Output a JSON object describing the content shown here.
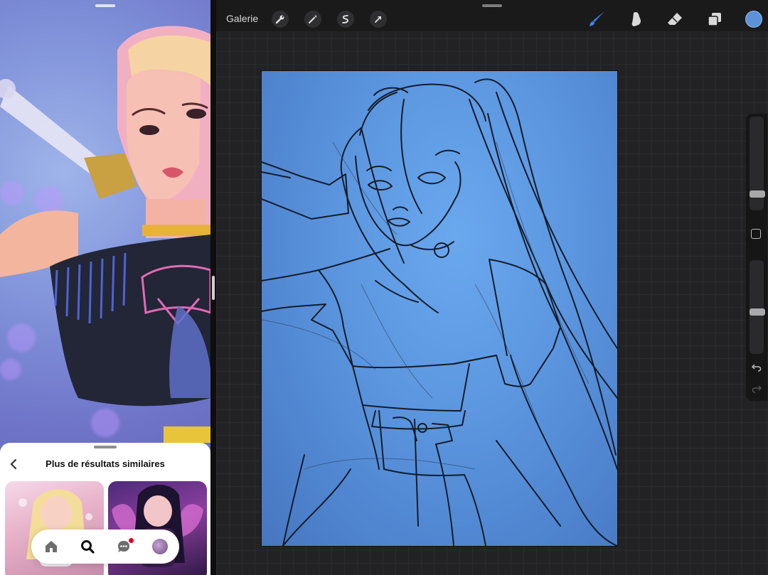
{
  "pinterest": {
    "sheet_title": "Plus de résultats similaires",
    "icons": {
      "back": "chevron-left-icon",
      "home": "home-icon",
      "search": "search-icon",
      "messages": "chat-bubble-icon",
      "profile": "avatar"
    },
    "notification_color": "#e60023"
  },
  "procreate": {
    "gallery_label": "Galerie",
    "toolbar_icons": [
      "wrench-icon",
      "magic-wand-icon",
      "selection-icon",
      "transform-arrow-icon"
    ],
    "right_tools": [
      "brush-icon",
      "smudge-icon",
      "eraser-icon",
      "layers-icon"
    ],
    "active_tool": "brush",
    "active_color": "#5e92d8",
    "brush_size_level": 0.45,
    "opacity_level": 0.3
  }
}
